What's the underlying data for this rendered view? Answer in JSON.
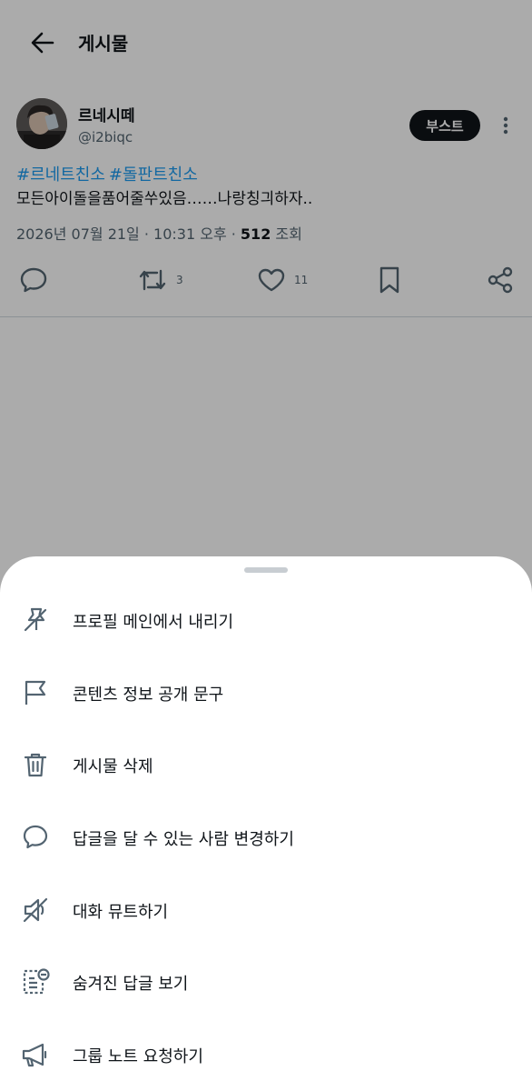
{
  "header": {
    "title": "게시물",
    "back_icon": "arrow-left-icon"
  },
  "post": {
    "author_name": "르네시떼",
    "author_handle": "@i2biqc",
    "boost_label": "부스트",
    "hashtags": [
      "#르네트친소",
      "#돌판트친소"
    ],
    "text": "모든아이돌을품어줄쑤있음……나랑칭긔하자..",
    "date": "2026년 07월 21일 · 10:31 오후 · ",
    "views": "512",
    "views_label": " 조회",
    "retweet_count": "3",
    "like_count": "11"
  },
  "sheet": {
    "items": [
      {
        "label": "프로필 메인에서 내리기",
        "icon": "unpin-icon"
      },
      {
        "label": "콘텐츠 정보 공개 문구",
        "icon": "flag-icon"
      },
      {
        "label": "게시물 삭제",
        "icon": "trash-icon"
      },
      {
        "label": "답글을 달 수 있는 사람 변경하기",
        "icon": "reply-bubble-icon"
      },
      {
        "label": "대화 뮤트하기",
        "icon": "mute-icon"
      },
      {
        "label": "숨겨진 답글 보기",
        "icon": "hidden-replies-icon"
      },
      {
        "label": "그룹 노트 요청하기",
        "icon": "megaphone-icon"
      }
    ]
  },
  "colors": {
    "accent": "#1d9bf0",
    "text": "#0f1419",
    "muted": "#536471",
    "scrim": "rgba(0,0,0,0.33)"
  }
}
